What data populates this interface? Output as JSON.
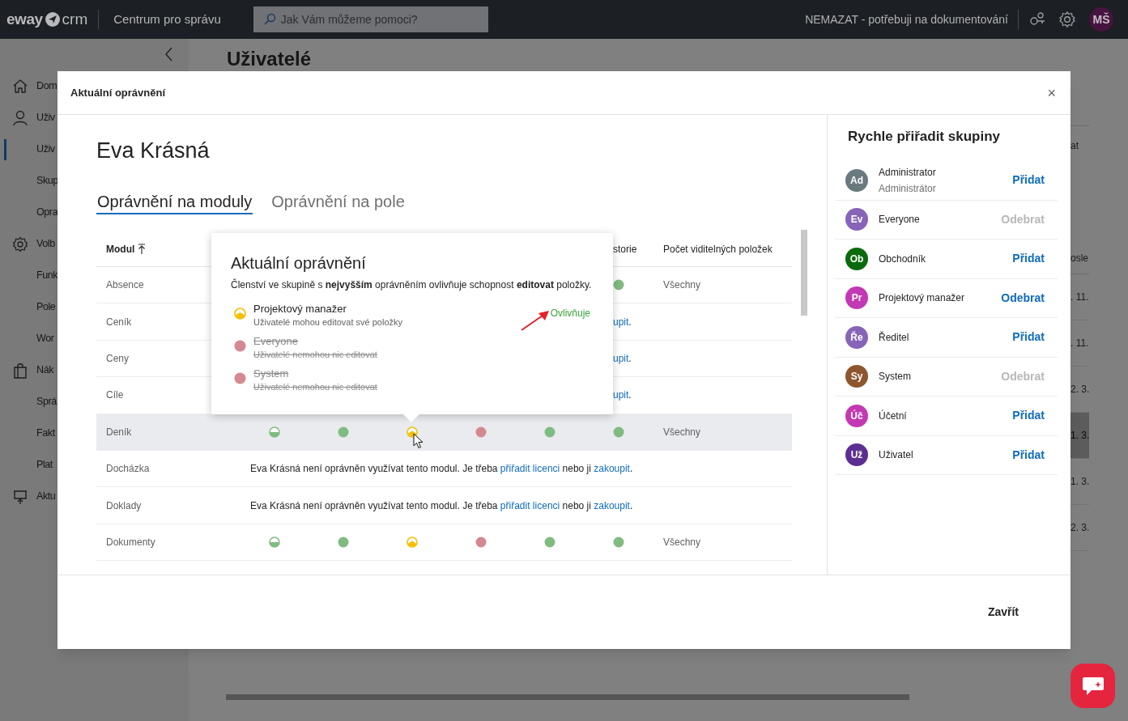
{
  "top_bar": {
    "logo_left": "eway",
    "logo_right": "crm",
    "app_title": "Centrum pro správu",
    "search": {
      "placeholder": "Jak Vám můžeme pomoci?"
    },
    "environment": "NEMAZAT - potřebuji na dokumentování",
    "user_initials": "MŠ"
  },
  "sidebar": {
    "items": [
      {
        "label": "Dom",
        "kind": "section",
        "selected": false
      },
      {
        "label": "Uživ",
        "kind": "section",
        "selected": false
      },
      {
        "label": "Uživ",
        "kind": "sub",
        "selected": true
      },
      {
        "label": "Skup",
        "kind": "sub",
        "selected": false
      },
      {
        "label": "Opra",
        "kind": "sub",
        "selected": false
      },
      {
        "label": "Volb",
        "kind": "section",
        "selected": false
      },
      {
        "label": "Funk",
        "kind": "sub",
        "selected": false
      },
      {
        "label": "Pole",
        "kind": "sub",
        "selected": false
      },
      {
        "label": "Wor",
        "kind": "sub",
        "selected": false
      },
      {
        "label": "Nák",
        "kind": "section",
        "selected": false
      },
      {
        "label": "Sprá",
        "kind": "sub",
        "selected": false
      },
      {
        "label": "Fakt",
        "kind": "sub",
        "selected": false
      },
      {
        "label": "Plat",
        "kind": "sub",
        "selected": false
      },
      {
        "label": "Aktu",
        "kind": "section",
        "selected": false
      }
    ]
  },
  "background": {
    "title": "Uživatelé",
    "fragments": [
      {
        "text": "at",
        "kind": "header",
        "selected": false
      },
      {
        "text": "osle",
        "kind": "header",
        "selected": false
      },
      {
        "text": ". 11.",
        "kind": "cell",
        "selected": false
      },
      {
        "text": ". 11.",
        "kind": "cell",
        "selected": false
      },
      {
        "text": "2. 3.",
        "kind": "cell",
        "selected": false
      },
      {
        "text": "1. 3.",
        "kind": "cell",
        "selected": true
      },
      {
        "text": "1. 3.",
        "kind": "cell",
        "selected": false
      },
      {
        "text": "2. 3.",
        "kind": "cell",
        "selected": false
      }
    ]
  },
  "modal": {
    "title": "Aktuální oprávnění",
    "close": "×",
    "user_name": "Eva Krásná",
    "tabs": [
      {
        "label": "Oprávnění na moduly",
        "selected": true
      },
      {
        "label": "Oprávnění na pole",
        "selected": false
      }
    ],
    "table": {
      "columns": [
        {
          "label": "Modul",
          "kind": "module",
          "sorted": true
        },
        {
          "label": "storie",
          "kind": "fragment",
          "sorted": false
        },
        {
          "label": "Počet viditelných položek",
          "kind": "count",
          "sorted": false
        }
      ],
      "rows": [
        {
          "module": "Absence",
          "kind": "permissions_partial",
          "selected": false,
          "permissions": [
            {
              "kind": "full"
            }
          ],
          "count": "Všechny"
        },
        {
          "module": "Ceník",
          "kind": "license_fragment",
          "selected": false,
          "link": "upit",
          "end": "."
        },
        {
          "module": "Ceny",
          "kind": "license_fragment",
          "selected": false,
          "link": "upit",
          "end": "."
        },
        {
          "module": "Cíle",
          "kind": "license_fragment",
          "selected": false,
          "link": "upit",
          "end": "."
        },
        {
          "module": "Deník",
          "kind": "permissions",
          "selected": true,
          "permissions": [
            {
              "kind": "half"
            },
            {
              "kind": "full"
            },
            {
              "kind": "own"
            },
            {
              "kind": "denied"
            },
            {
              "kind": "full"
            },
            {
              "kind": "full"
            }
          ],
          "count": "Všechny"
        },
        {
          "module": "Docházka",
          "kind": "license",
          "selected": false,
          "text": "Eva Krásná není oprávněn využívat tento modul. Je třeba ",
          "link_1": "přiřadit licenci",
          "middle": " nebo ji ",
          "link_2": "zakoupit",
          "end": "."
        },
        {
          "module": "Doklady",
          "kind": "license",
          "selected": false,
          "text": "Eva Krásná není oprávněn využívat tento modul. Je třeba ",
          "link_1": "přiřadit licenci",
          "middle": " nebo ji ",
          "link_2": "zakoupit",
          "end": "."
        },
        {
          "module": "Dokumenty",
          "kind": "permissions",
          "selected": false,
          "permissions": [
            {
              "kind": "half"
            },
            {
              "kind": "full"
            },
            {
              "kind": "own"
            },
            {
              "kind": "denied"
            },
            {
              "kind": "full"
            },
            {
              "kind": "full"
            }
          ],
          "count": "Všechny"
        }
      ]
    },
    "popover": {
      "title": "Aktuální oprávnění",
      "description": "Členství ve skupině s **nejvyšším** oprávněním ovlivňuje schopnost **editovat** položky.",
      "groups": [
        {
          "name": "Projektový manažer",
          "description": "Uživatelé mohou editovat své položky",
          "kind": "own",
          "struck": false,
          "note": "Ovlivňuje"
        },
        {
          "name": "Everyone",
          "description": "Uživatelé nemohou nic editovat",
          "kind": "denied",
          "struck": true
        },
        {
          "name": "System",
          "description": "Uživatelé nemohou nic editovat",
          "kind": "denied",
          "struck": true
        }
      ]
    },
    "quick_assign": {
      "title": "Rychle přiřadit skupiny",
      "groups": [
        {
          "initials": "Ad",
          "name": "Administrator",
          "subtitle": "Administrátor",
          "color": "#69797e",
          "action": "Přidat",
          "action_disabled": false
        },
        {
          "initials": "Ev",
          "name": "Everyone",
          "color": "#8764b8",
          "action": "Odebrat",
          "action_disabled": true
        },
        {
          "initials": "Ob",
          "name": "Obchodník",
          "color": "#0b6a0b",
          "action": "Přidat",
          "action_disabled": false
        },
        {
          "initials": "Pr",
          "name": "Projektový manažer",
          "color": "#c239b3",
          "action": "Odebrat",
          "action_disabled": false
        },
        {
          "initials": "Ře",
          "name": "Ředitel",
          "color": "#8764b8",
          "action": "Přidat",
          "action_disabled": false
        },
        {
          "initials": "Sy",
          "name": "System",
          "color": "#8e562e",
          "action": "Odebrat",
          "action_disabled": true
        },
        {
          "initials": "Úč",
          "name": "Účetní",
          "color": "#c239b3",
          "action": "Přidat",
          "action_disabled": false
        },
        {
          "initials": "Už",
          "name": "Uživatel",
          "color": "#5c2e91",
          "action": "Přidat",
          "action_disabled": false
        }
      ]
    },
    "close_button": "Zavřít"
  }
}
